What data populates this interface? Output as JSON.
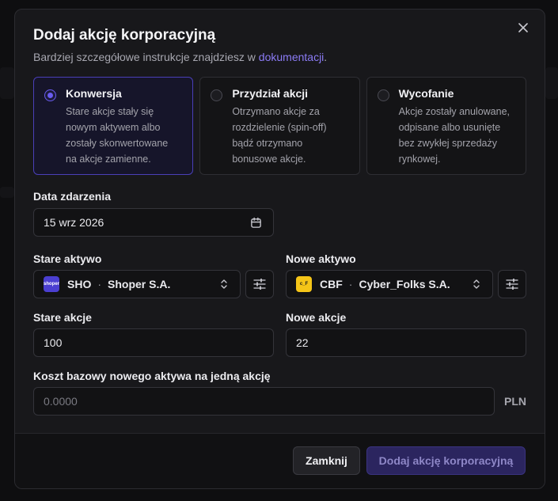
{
  "modal": {
    "title": "Dodaj akcję korporacyjną",
    "subtitle_prefix": "Bardziej szczegółowe instrukcje znajdziesz w ",
    "subtitle_link": "dokumentacji",
    "subtitle_suffix": "."
  },
  "options": [
    {
      "title": "Konwersja",
      "desc": [
        "Stare akcje stały się",
        "nowym aktywem albo",
        "zostały skonwertowane",
        "na akcje zamienne."
      ],
      "selected": true
    },
    {
      "title": "Przydział akcji",
      "desc": [
        "Otrzymano akcje za",
        "rozdzielenie (spin-off)",
        "bądź otrzymano",
        "bonusowe akcje."
      ],
      "selected": false
    },
    {
      "title": "Wycofanie",
      "desc": [
        "Akcje zostały anulowane,",
        "odpisane albo usunięte",
        "bez zwykłej sprzedaży",
        "rynkowej."
      ],
      "selected": false
    }
  ],
  "event_date": {
    "label": "Data zdarzenia",
    "value": "15 wrz 2026"
  },
  "old_asset": {
    "label": "Stare aktywo",
    "ticker": "SHO",
    "separator": "·",
    "name": "Shoper S.A.",
    "icon_text": "shoper",
    "icon_color": "#4b3fd1"
  },
  "new_asset": {
    "label": "Nowe aktywo",
    "ticker": "CBF",
    "separator": "·",
    "name": "Cyber_Folks S.A.",
    "icon_text": "c_F",
    "icon_color": "#f5c518"
  },
  "old_shares": {
    "label": "Stare akcje",
    "value": "100"
  },
  "new_shares": {
    "label": "Nowe akcje",
    "value": "22"
  },
  "cost_basis": {
    "label": "Koszt bazowy nowego aktywa na jedną akcję",
    "placeholder": "0.0000",
    "unit": "PLN"
  },
  "footer": {
    "cancel_label": "Zamknij",
    "submit_label": "Dodaj akcję korporacyjną"
  },
  "colors": {
    "accent": "#6a5cf0",
    "link": "#8b7bf5",
    "submit_bg": "#2b255f"
  }
}
